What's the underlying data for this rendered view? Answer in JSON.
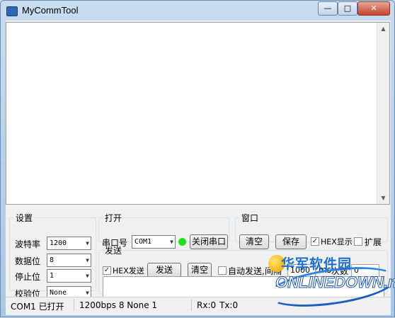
{
  "window": {
    "title": "MyCommTool",
    "min_glyph": "—",
    "max_glyph": "□",
    "close_glyph": "✕"
  },
  "settings": {
    "legend": "设置",
    "baud_label": "波特率",
    "baud_value": "1200",
    "databits_label": "数据位",
    "databits_value": "8",
    "stopbits_label": "停止位",
    "stopbits_value": "1",
    "parity_label": "校验位",
    "parity_value": "None"
  },
  "open": {
    "legend": "打开",
    "port_label": "串口号",
    "port_value": "COM1",
    "status_color": "#1de11d",
    "close_button": "关闭串口"
  },
  "window_group": {
    "legend": "窗口",
    "clear_button": "清空",
    "save_button": "保存",
    "hex_display_label": "HEX显示",
    "hex_display_checked": true,
    "expand_label": "扩展",
    "expand_checked": false
  },
  "send": {
    "legend": "发送",
    "hex_send_label": "HEX发送",
    "hex_send_checked": true,
    "send_button": "发送",
    "clear_button": "清空",
    "auto_send_label": "自动发送,间隔",
    "auto_send_checked": false,
    "interval_value": "1000",
    "interval_unit": "ms",
    "count_label": "次数",
    "count_value": "0"
  },
  "status": {
    "port_state": "COM1 已打开",
    "params": "1200bps  8  None  1",
    "rx": "Rx:0",
    "tx": "Tx:0"
  },
  "watermark": {
    "cn": "华军软件园",
    "en": "ONLINEDOWN.net"
  },
  "icons": {
    "dropdown": "▼",
    "check": "✓",
    "scroll_up": "▲",
    "scroll_down": "▼"
  }
}
